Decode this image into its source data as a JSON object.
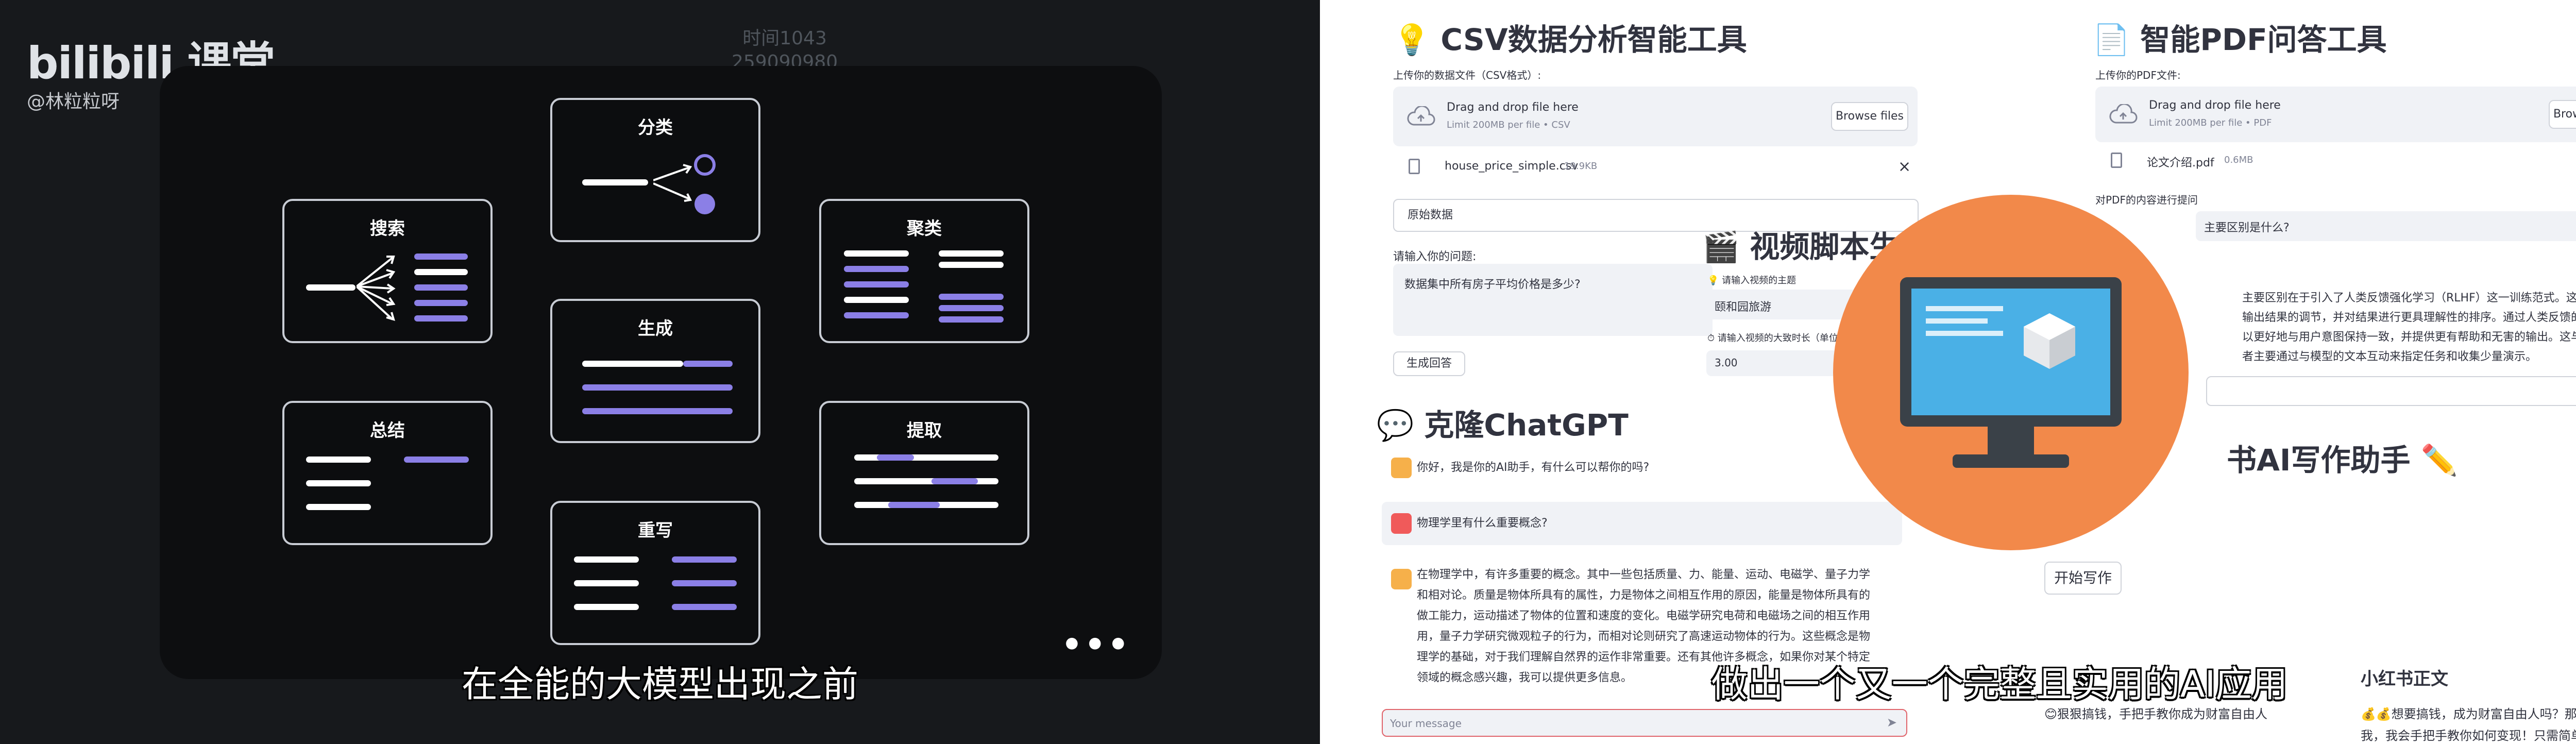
{
  "left": {
    "brand": "bilibili 课堂",
    "author": "@林粒粒呀",
    "timestamp_line1": "时间1043",
    "timestamp_line2": "259090980",
    "cards": {
      "classify": "分类",
      "search": "搜索",
      "cluster": "聚类",
      "generate": "生成",
      "summarize": "总结",
      "extract": "提取",
      "rewrite": "重写"
    },
    "more": "•••",
    "subtitle": "在全能的大模型出现之前"
  },
  "right": {
    "csv_tool": {
      "title": "💡 CSV数据分析智能工具",
      "upload_label": "上传你的数据文件（CSV格式）:",
      "drop_text": "Drag and drop file here",
      "limit_text": "Limit 200MB per file • CSV",
      "browse": "Browse files",
      "file_name": "house_price_simple.csv",
      "file_size": "19.9KB",
      "expander": "原始数据",
      "question_label": "请输入你的问题:",
      "question_value": "数据集中所有房子平均价格是多少?",
      "submit": "生成回答"
    },
    "pdf_tool": {
      "title": "📄 智能PDF问答工具",
      "upload_label": "上传你的PDF文件:",
      "drop_text": "Drag and drop file here",
      "limit_text": "Limit 200MB per file • PDF",
      "browse": "Browse files",
      "file_name": "论文介绍.pdf",
      "file_size": "0.6MB",
      "question_label": "对PDF的内容进行提问",
      "question_value": "主要区别是什么?",
      "answer_lines": [
        "主要区别在于引入了人类反馈强化学习（RLHF）这一训练范式。这种",
        "输出结果的调节，并对结果进行更具理解性的排序。通过人类反馈的微",
        "以更好地与用户意图保持一致，并提供更有帮助和无害的输出。这与",
        "者主要通过与模型的文本互动来指定任务和收集少量演示。"
      ]
    },
    "video_tool": {
      "title": "🎬 视频脚本生成",
      "topic_label": "💡 请输入视频的主题",
      "topic_value": "颐和园旅游",
      "length_label": "⏱ 请输入视频的大致时长（单位：分钟）",
      "length_value": "3.00"
    },
    "chatgpt": {
      "title": "💬 克隆ChatGPT",
      "messages": [
        "你好，我是你的AI助手，有什么可以帮你的吗?",
        "物理学里有什么重要概念?"
      ],
      "answer_lines": [
        "在物理学中，有许多重要的概念。其中一些包括质量、力、能量、运动、电磁学、量子力学",
        "和相对论。质量是物体所具有的属性，力是物体之间相互作用的原因，能量是物体所具有的",
        "做工能力，运动描述了物体的位置和速度的变化。电磁学研究电荷和电磁场之间的相互作用",
        "用，量子力学研究微观粒子的行为，而相对论则研究了高速运动物体的行为。这些概念是物",
        "理学的基础，对于我们理解自然界的运作非常重要。还有其他许多概念，如果你对某个特定",
        "领域的概念感兴趣，我可以提供更多信息。"
      ],
      "input_placeholder": "Your message"
    },
    "xhs_tool": {
      "title": "书AI写作助手 ✏️",
      "start_button": "开始写作",
      "body_title": "小红书正文",
      "body_left": "😊狠狠搞钱，手把手教你成为财富自由人",
      "body_right_1": "💰💰想要搞钱，成为财富自由人吗？那就跟着",
      "body_right_2": "我，我会手把手教你如何变现！只需简单的几个"
    },
    "subtitle": "做出一个又一个完整且实用的AI应用"
  },
  "colors": {
    "accent_purple": "#8b7fe6",
    "streamlit_text": "#31333f",
    "icon_orange": "#f2894a",
    "monitor_screen": "#4ab0e6"
  }
}
